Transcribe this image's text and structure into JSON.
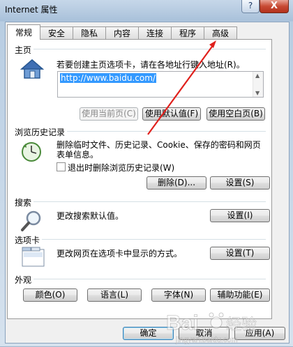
{
  "window": {
    "title": "Internet 属性",
    "help_glyph": "?",
    "close_glyph": "X"
  },
  "tabs": [
    {
      "label": "常规",
      "active": true
    },
    {
      "label": "安全"
    },
    {
      "label": "隐私"
    },
    {
      "label": "内容"
    },
    {
      "label": "连接"
    },
    {
      "label": "程序"
    },
    {
      "label": "高级"
    }
  ],
  "homepage": {
    "group_title": "主页",
    "instruction": "若要创建主页选项卡，请在各地址行键入地址(R)。",
    "url_value": "http://www.baidu.com/",
    "use_current": "使用当前页(C)",
    "use_default": "使用默认值(F)",
    "use_blank": "使用空白页(B)"
  },
  "history": {
    "group_title": "浏览历史记录",
    "desc_line1": "删除临时文件、历史记录、Cookie、保存的密码和网页",
    "desc_line2": "表单信息。",
    "checkbox_label": "退出时删除浏览历史记录(W)",
    "delete_button": "删除(D)...",
    "settings_button": "设置(S)"
  },
  "search": {
    "group_title": "搜索",
    "desc": "更改搜索默认值。",
    "settings_button": "设置(I)"
  },
  "tabs_section": {
    "group_title": "选项卡",
    "desc": "更改网页在选项卡中显示的方式。",
    "settings_button": "设置(T)"
  },
  "appearance": {
    "group_title": "外观",
    "colors_button": "颜色(O)",
    "languages_button": "语言(L)",
    "fonts_button": "字体(N)",
    "accessibility_button": "辅助功能(E)"
  },
  "footer": {
    "ok_button": "确定",
    "cancel_button": "取消",
    "apply_button": "应用(A)"
  },
  "watermark": {
    "brand": "Bai",
    "brand2": "经验",
    "url": "jingyan.baidu.com"
  },
  "colors": {
    "selection": "#3399ff",
    "annotation_arrow": "#e0201c"
  }
}
